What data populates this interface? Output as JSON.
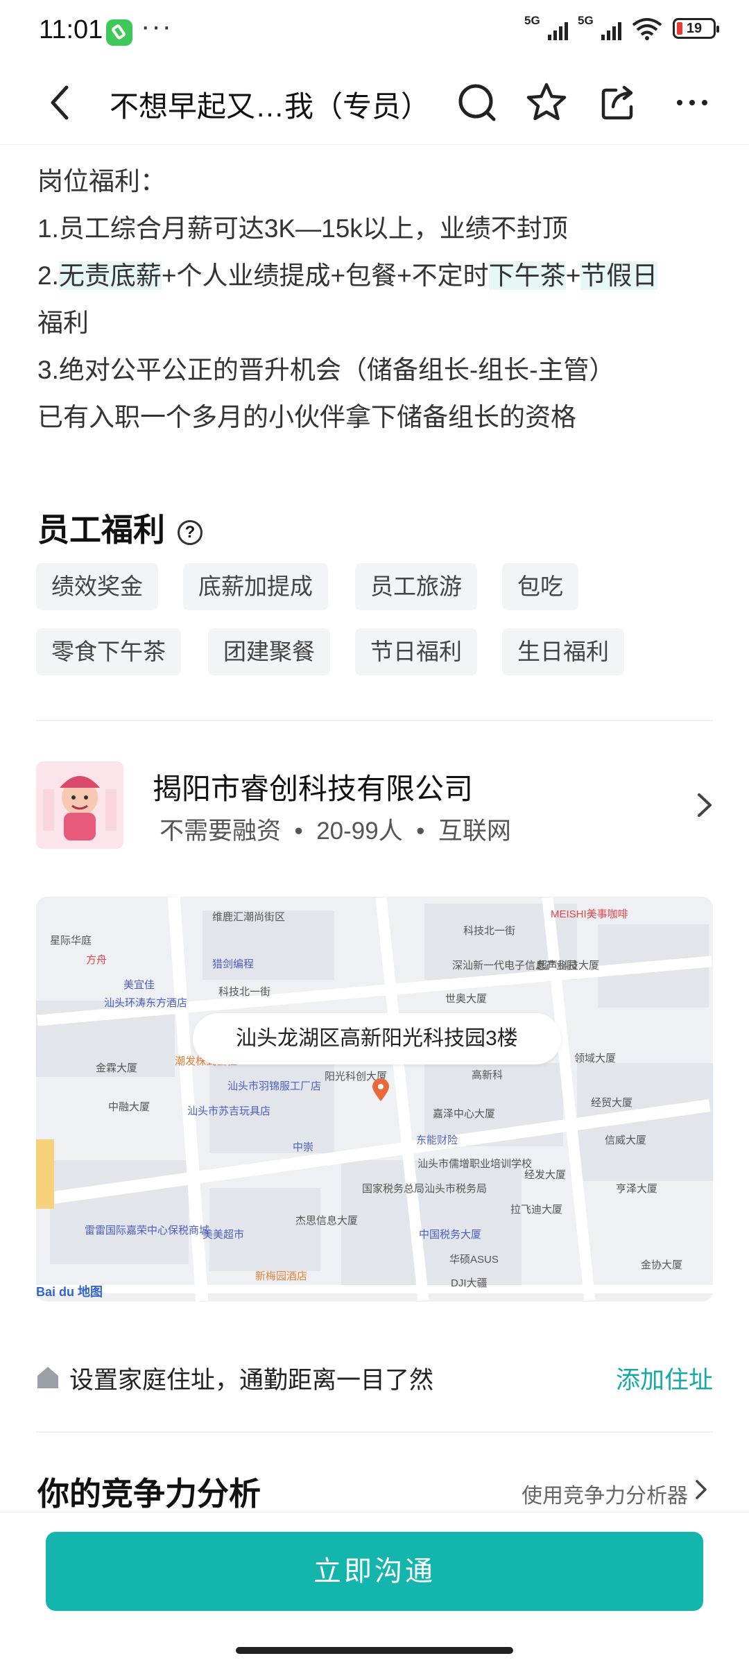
{
  "status_bar": {
    "time": "11:01",
    "more": "···",
    "signal_label_1": "5G",
    "signal_label_2": "5G",
    "battery_level": "19"
  },
  "nav": {
    "title": "不想早起又…我（专员）",
    "icons": [
      "back-icon",
      "search-icon",
      "star-icon",
      "share-icon",
      "more-icon"
    ]
  },
  "description": {
    "benefits_heading": "岗位福利：",
    "line1": "1.员工综合月薪可达3K—15k以上，业绩不封顶",
    "line2_a": "2.",
    "line2_hl1": "无责底薪",
    "line2_b": "+个人业绩提成+包餐+不定时",
    "line2_hl2": "下午茶",
    "line2_c": "+",
    "line2_hl3": "节假日",
    "line2_d": "福利",
    "line3": "3.绝对公平公正的晋升机会（储备组长-组长-主管）",
    "line4": "已有入职一个多月的小伙伴拿下储备组长的资格"
  },
  "welfare": {
    "title": "员工福利",
    "help": "?",
    "tags": [
      "绩效奖金",
      "底薪加提成",
      "员工旅游",
      "包吃",
      "零食下午茶",
      "团建聚餐",
      "节日福利",
      "生日福利"
    ]
  },
  "company": {
    "name": "揭阳市睿创科技有限公司",
    "funding": "不需要融资",
    "size": "20-99人",
    "industry": "互联网",
    "sep": "•"
  },
  "map": {
    "address": "汕头龙湖区高新阳光科技园3楼",
    "pois": [
      "维鹿汇潮尚街区",
      "星际华庭",
      "方舟",
      "猎剑编程",
      "美宜佳",
      "汕头环涛东方酒店",
      "科技北一街",
      "深汕新一代电子信息产业园",
      "世奥大厦",
      "超声科技大厦",
      "金霖大厦",
      "潮发株式会社",
      "汕头市羽锦服工厂店",
      "阳光科创大厦",
      "高新科",
      "领域大厦",
      "中融大厦",
      "汕头市苏吉玩具店",
      "嘉泽中心大厦",
      "经贸大厦",
      "信威大厦",
      "中崇",
      "东能财险",
      "汕头市儒增职业培训学校",
      "经发大厦",
      "亨泽大厦",
      "雷雷国际嘉荣中心保税商城",
      "美美超市",
      "杰思信息大厦",
      "国家税务总局汕头市税务局",
      "拉飞迪大厦",
      "中国税务大厦",
      "新梅园酒店",
      "华硕ASUS",
      "DJI大疆",
      "金协大厦",
      "MEISHI美事咖啡",
      "科技北一街"
    ],
    "attribution": "Bai du 地图"
  },
  "home": {
    "text": "设置家庭住址，通勤距离一目了然",
    "action": "添加住址"
  },
  "competitiveness": {
    "title": "你的竞争力分析",
    "tool": "使用竞争力分析器"
  },
  "cta": {
    "label": "立即沟通"
  },
  "colors": {
    "accent": "#14b5ad",
    "link": "#14aaa6",
    "highlight": "#e6f7f5",
    "tag_bg": "#f3f4f5"
  }
}
